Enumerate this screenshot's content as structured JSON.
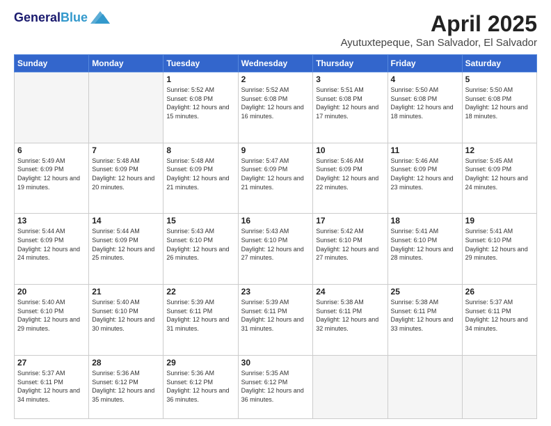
{
  "header": {
    "logo_general": "General",
    "logo_blue": "Blue",
    "month_title": "April 2025",
    "location": "Ayutuxtepeque, San Salvador, El Salvador"
  },
  "weekdays": [
    "Sunday",
    "Monday",
    "Tuesday",
    "Wednesday",
    "Thursday",
    "Friday",
    "Saturday"
  ],
  "weeks": [
    [
      {
        "day": "",
        "info": ""
      },
      {
        "day": "",
        "info": ""
      },
      {
        "day": "1",
        "info": "Sunrise: 5:52 AM\nSunset: 6:08 PM\nDaylight: 12 hours and 15 minutes."
      },
      {
        "day": "2",
        "info": "Sunrise: 5:52 AM\nSunset: 6:08 PM\nDaylight: 12 hours and 16 minutes."
      },
      {
        "day": "3",
        "info": "Sunrise: 5:51 AM\nSunset: 6:08 PM\nDaylight: 12 hours and 17 minutes."
      },
      {
        "day": "4",
        "info": "Sunrise: 5:50 AM\nSunset: 6:08 PM\nDaylight: 12 hours and 18 minutes."
      },
      {
        "day": "5",
        "info": "Sunrise: 5:50 AM\nSunset: 6:08 PM\nDaylight: 12 hours and 18 minutes."
      }
    ],
    [
      {
        "day": "6",
        "info": "Sunrise: 5:49 AM\nSunset: 6:09 PM\nDaylight: 12 hours and 19 minutes."
      },
      {
        "day": "7",
        "info": "Sunrise: 5:48 AM\nSunset: 6:09 PM\nDaylight: 12 hours and 20 minutes."
      },
      {
        "day": "8",
        "info": "Sunrise: 5:48 AM\nSunset: 6:09 PM\nDaylight: 12 hours and 21 minutes."
      },
      {
        "day": "9",
        "info": "Sunrise: 5:47 AM\nSunset: 6:09 PM\nDaylight: 12 hours and 21 minutes."
      },
      {
        "day": "10",
        "info": "Sunrise: 5:46 AM\nSunset: 6:09 PM\nDaylight: 12 hours and 22 minutes."
      },
      {
        "day": "11",
        "info": "Sunrise: 5:46 AM\nSunset: 6:09 PM\nDaylight: 12 hours and 23 minutes."
      },
      {
        "day": "12",
        "info": "Sunrise: 5:45 AM\nSunset: 6:09 PM\nDaylight: 12 hours and 24 minutes."
      }
    ],
    [
      {
        "day": "13",
        "info": "Sunrise: 5:44 AM\nSunset: 6:09 PM\nDaylight: 12 hours and 24 minutes."
      },
      {
        "day": "14",
        "info": "Sunrise: 5:44 AM\nSunset: 6:09 PM\nDaylight: 12 hours and 25 minutes."
      },
      {
        "day": "15",
        "info": "Sunrise: 5:43 AM\nSunset: 6:10 PM\nDaylight: 12 hours and 26 minutes."
      },
      {
        "day": "16",
        "info": "Sunrise: 5:43 AM\nSunset: 6:10 PM\nDaylight: 12 hours and 27 minutes."
      },
      {
        "day": "17",
        "info": "Sunrise: 5:42 AM\nSunset: 6:10 PM\nDaylight: 12 hours and 27 minutes."
      },
      {
        "day": "18",
        "info": "Sunrise: 5:41 AM\nSunset: 6:10 PM\nDaylight: 12 hours and 28 minutes."
      },
      {
        "day": "19",
        "info": "Sunrise: 5:41 AM\nSunset: 6:10 PM\nDaylight: 12 hours and 29 minutes."
      }
    ],
    [
      {
        "day": "20",
        "info": "Sunrise: 5:40 AM\nSunset: 6:10 PM\nDaylight: 12 hours and 29 minutes."
      },
      {
        "day": "21",
        "info": "Sunrise: 5:40 AM\nSunset: 6:10 PM\nDaylight: 12 hours and 30 minutes."
      },
      {
        "day": "22",
        "info": "Sunrise: 5:39 AM\nSunset: 6:11 PM\nDaylight: 12 hours and 31 minutes."
      },
      {
        "day": "23",
        "info": "Sunrise: 5:39 AM\nSunset: 6:11 PM\nDaylight: 12 hours and 31 minutes."
      },
      {
        "day": "24",
        "info": "Sunrise: 5:38 AM\nSunset: 6:11 PM\nDaylight: 12 hours and 32 minutes."
      },
      {
        "day": "25",
        "info": "Sunrise: 5:38 AM\nSunset: 6:11 PM\nDaylight: 12 hours and 33 minutes."
      },
      {
        "day": "26",
        "info": "Sunrise: 5:37 AM\nSunset: 6:11 PM\nDaylight: 12 hours and 34 minutes."
      }
    ],
    [
      {
        "day": "27",
        "info": "Sunrise: 5:37 AM\nSunset: 6:11 PM\nDaylight: 12 hours and 34 minutes."
      },
      {
        "day": "28",
        "info": "Sunrise: 5:36 AM\nSunset: 6:12 PM\nDaylight: 12 hours and 35 minutes."
      },
      {
        "day": "29",
        "info": "Sunrise: 5:36 AM\nSunset: 6:12 PM\nDaylight: 12 hours and 36 minutes."
      },
      {
        "day": "30",
        "info": "Sunrise: 5:35 AM\nSunset: 6:12 PM\nDaylight: 12 hours and 36 minutes."
      },
      {
        "day": "",
        "info": ""
      },
      {
        "day": "",
        "info": ""
      },
      {
        "day": "",
        "info": ""
      }
    ]
  ]
}
